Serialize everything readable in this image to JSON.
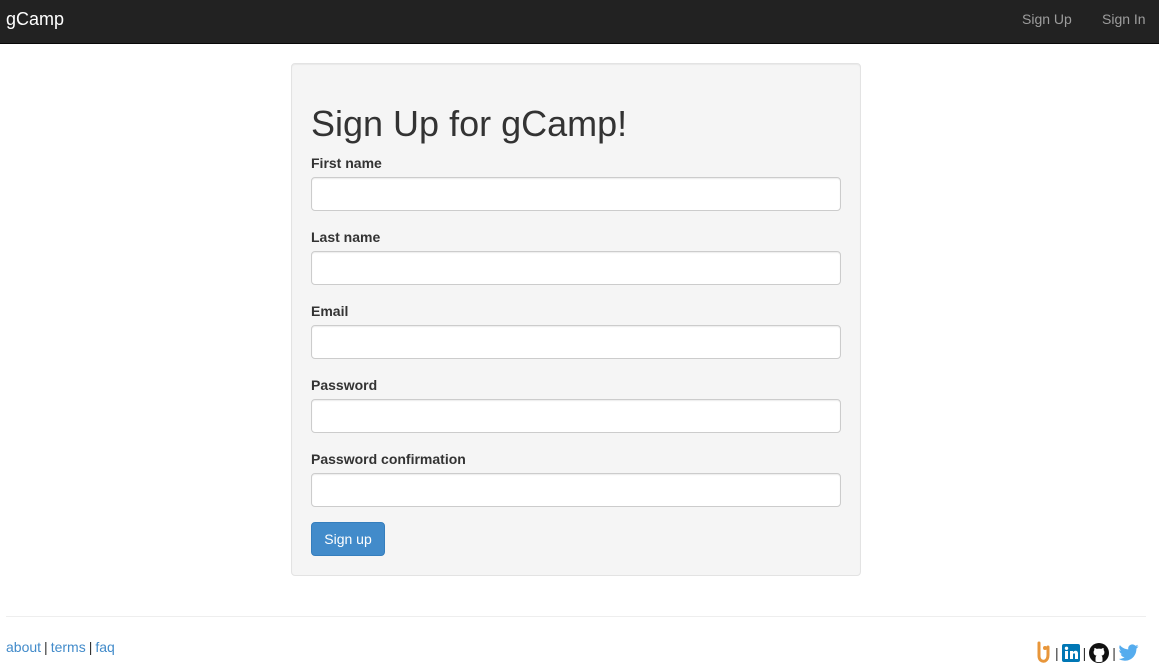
{
  "navbar": {
    "brand": "gCamp",
    "links": [
      {
        "label": "Sign Up"
      },
      {
        "label": "Sign In"
      }
    ]
  },
  "form": {
    "title": "Sign Up for gCamp!",
    "fields": [
      {
        "label": "First name",
        "value": ""
      },
      {
        "label": "Last name",
        "value": ""
      },
      {
        "label": "Email",
        "value": ""
      },
      {
        "label": "Password",
        "value": ""
      },
      {
        "label": "Password confirmation",
        "value": ""
      }
    ],
    "submit_label": "Sign up"
  },
  "footer": {
    "links": [
      {
        "label": "about"
      },
      {
        "label": "terms"
      },
      {
        "label": "faq"
      }
    ],
    "separator": "|",
    "social_icons": [
      "gcamp-logo-icon",
      "linkedin-icon",
      "github-icon",
      "twitter-icon"
    ]
  },
  "colors": {
    "navbar_bg": "#222222",
    "link": "#428bca",
    "button": "#428bca",
    "well_bg": "#f5f5f5",
    "gcamp_logo": "#e8963a",
    "linkedin": "#0077b5",
    "twitter": "#55acee"
  }
}
